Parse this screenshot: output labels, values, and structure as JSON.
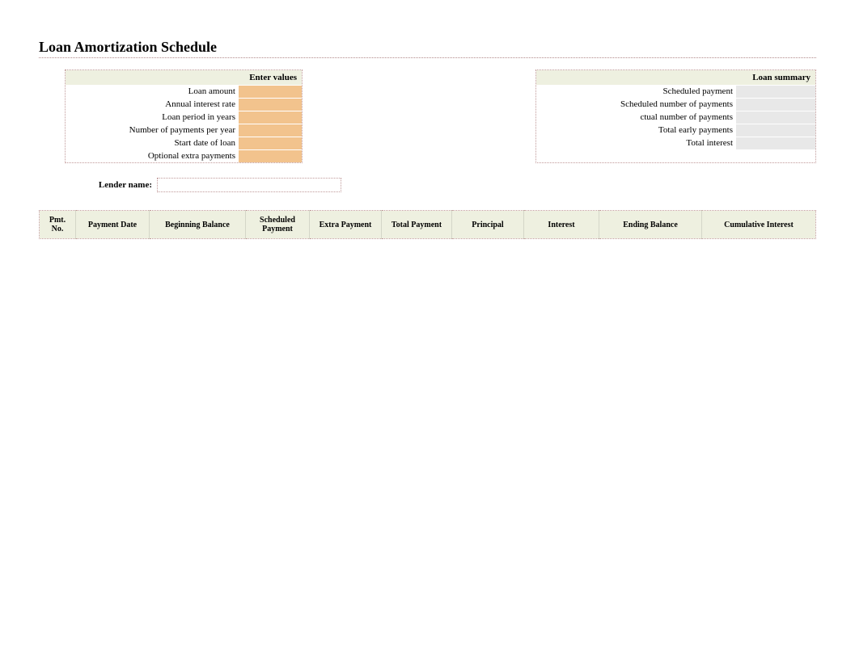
{
  "title": "Loan Amortization Schedule",
  "inputs": {
    "header": "Enter values",
    "rows": [
      {
        "label": "Loan amount",
        "value": ""
      },
      {
        "label": "Annual interest rate",
        "value": ""
      },
      {
        "label": "Loan period in years",
        "value": ""
      },
      {
        "label": "Number of payments per year",
        "value": ""
      },
      {
        "label": "Start date of loan",
        "value": ""
      },
      {
        "label": "Optional extra payments",
        "value": ""
      }
    ]
  },
  "summary": {
    "header": "Loan summary",
    "rows": [
      {
        "label": "Scheduled payment",
        "value": ""
      },
      {
        "label": "Scheduled number of payments",
        "value": ""
      },
      {
        "label": "ctual number of payments",
        "value": ""
      },
      {
        "label": "Total early payments",
        "value": ""
      },
      {
        "label": "Total interest",
        "value": ""
      }
    ]
  },
  "lender": {
    "label": "Lender name:",
    "value": ""
  },
  "schedule": {
    "columns": [
      "Pmt. No.",
      "Payment Date",
      "Beginning Balance",
      "Scheduled Payment",
      "Extra Payment",
      "Total Payment",
      "Principal",
      "Interest",
      "Ending Balance",
      "Cumulative Interest"
    ]
  }
}
